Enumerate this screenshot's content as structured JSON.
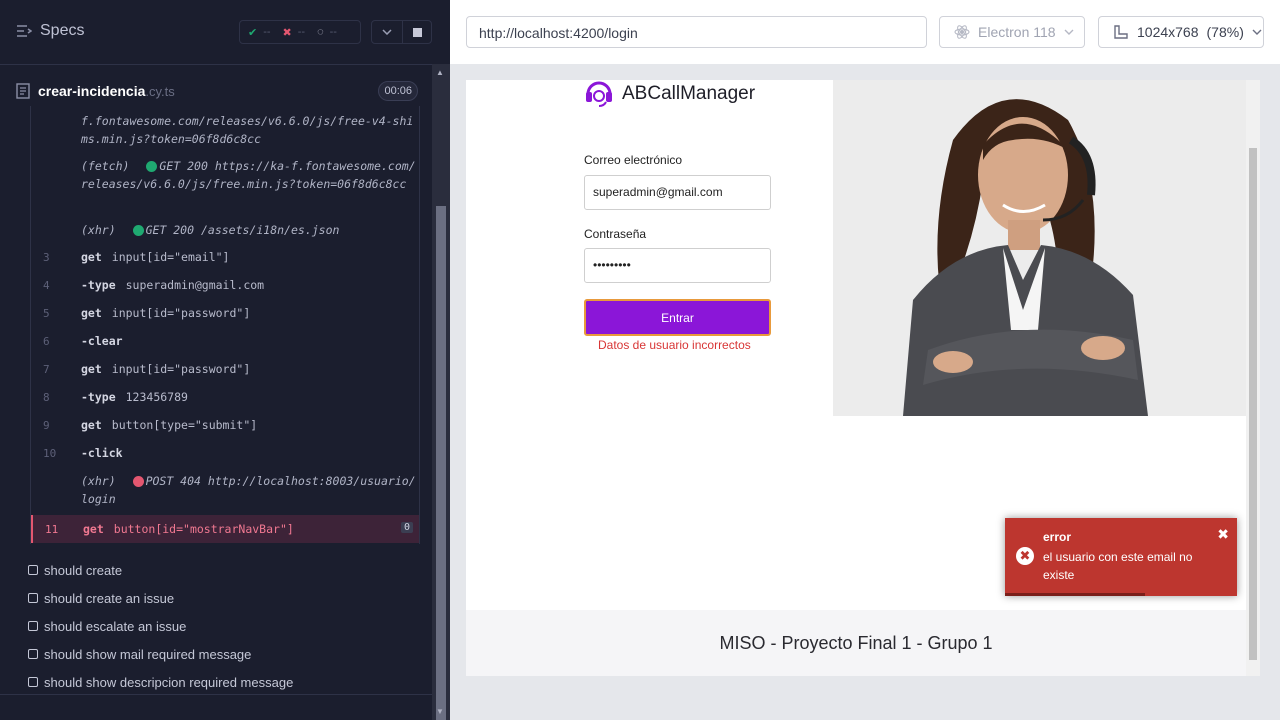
{
  "runner": {
    "specs_label": "Specs",
    "stats": {
      "passed": "--",
      "failed": "--",
      "pending": "--"
    },
    "spec": {
      "name": "crear-incidencia",
      "ext": ".cy.ts",
      "timer": "00:06"
    },
    "logs": [
      {
        "text": "f.fontawesome.com/releases/v6.6.0/js/free-v4-shims.min.js?token=06f8d6c8cc"
      },
      {
        "prefix": "(fetch)",
        "status": "GET 200",
        "text": "https://ka-f.fontawesome.com/releases/v6.6.0/js/free.min.js?token=06f8d6c8cc"
      },
      {
        "prefix": "(xhr)",
        "status": "GET 200",
        "text": "/assets/i18n/es.json"
      }
    ],
    "commands": [
      {
        "num": "3",
        "name": "get",
        "arg": "input[id=\"email\"]"
      },
      {
        "num": "4",
        "name": "-type",
        "arg": "superadmin@gmail.com"
      },
      {
        "num": "5",
        "name": "get",
        "arg": "input[id=\"password\"]"
      },
      {
        "num": "6",
        "name": "-clear",
        "arg": ""
      },
      {
        "num": "7",
        "name": "get",
        "arg": "input[id=\"password\"]"
      },
      {
        "num": "8",
        "name": "-type",
        "arg": "123456789"
      },
      {
        "num": "9",
        "name": "get",
        "arg": "button[type=\"submit\"]"
      },
      {
        "num": "10",
        "name": "-click",
        "arg": ""
      }
    ],
    "post_log": {
      "prefix": "(xhr)",
      "status": "POST 404",
      "text": "http://localhost:8003/usuario/login"
    },
    "failed_cmd": {
      "num": "11",
      "name": "get",
      "arg": "button[id=\"mostrarNavBar\"]",
      "badge": "0"
    },
    "tests": [
      "should create",
      "should create an issue",
      "should escalate an issue",
      "should show mail required message",
      "should show descripcion required message"
    ]
  },
  "browser": {
    "url": "http://localhost:4200/login",
    "engine": "Electron 118",
    "viewport": "1024x768",
    "scale": "(78%)"
  },
  "app": {
    "logo_text": "ABCallManager",
    "email_label": "Correo electrónico",
    "email_value": "superadmin@gmail.com",
    "password_label": "Contraseña",
    "password_value": "•••••••••",
    "submit_label": "Entrar",
    "error_text": "Datos de usuario incorrectos",
    "footer": "MISO - Proyecto Final 1 - Grupo 1",
    "toast": {
      "title": "error",
      "message": "el usuario con este email no existe",
      "close": "✖"
    }
  },
  "colors": {
    "purple": "#8b16d8",
    "toast_red": "#bd362f",
    "pass_green": "#1fa971",
    "fail_red": "#e45770"
  }
}
